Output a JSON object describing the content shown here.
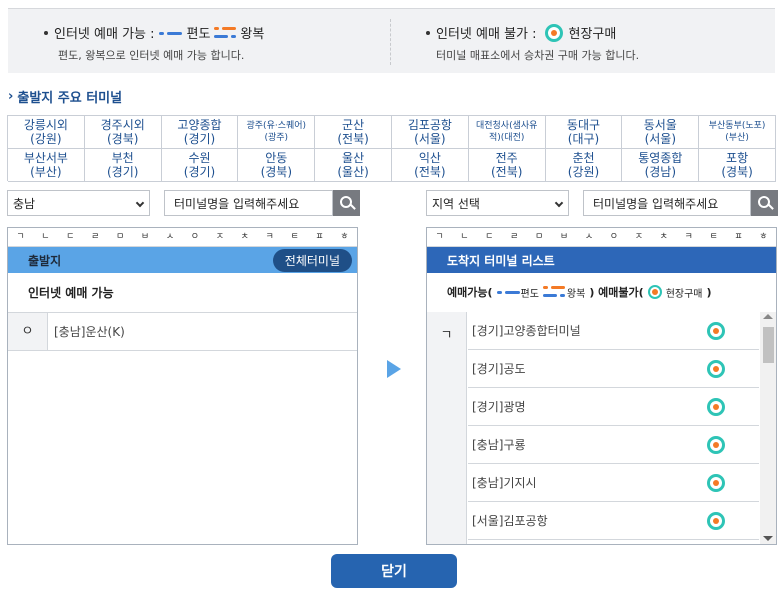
{
  "legend": {
    "online_label": "인터넷 예매 가능 :",
    "oneway_label": "편도",
    "roundtrip_label": "왕복",
    "online_desc": "편도, 왕복으로 인터넷 예매 가능 합니다.",
    "offline_label": "인터넷 예매 불가 :",
    "onsite_label": "현장구매",
    "offline_desc": "터미널 매표소에서 승차권 구매 가능 합니다."
  },
  "major": {
    "title": "출발지 주요 터미널",
    "terminals": [
      {
        "name": "강릉시외",
        "region": "(강원)",
        "small": false
      },
      {
        "name": "경주시외",
        "region": "(경북)",
        "small": false
      },
      {
        "name": "고양종합",
        "region": "(경기)",
        "small": false
      },
      {
        "name": "광주(유·스퀘어)",
        "region": "(광주)",
        "small": true
      },
      {
        "name": "군산",
        "region": "(전북)",
        "small": false
      },
      {
        "name": "김포공항",
        "region": "(서울)",
        "small": false
      },
      {
        "name": "대전청사(샘사유",
        "region": "적)(대전)",
        "small": true
      },
      {
        "name": "동대구",
        "region": "(대구)",
        "small": false
      },
      {
        "name": "동서울",
        "region": "(서울)",
        "small": false
      },
      {
        "name": "부산동부(노포)",
        "region": "(부산)",
        "small": true
      },
      {
        "name": "부산서부",
        "region": "(부산)",
        "small": false
      },
      {
        "name": "부천",
        "region": "(경기)",
        "small": false
      },
      {
        "name": "수원",
        "region": "(경기)",
        "small": false
      },
      {
        "name": "안동",
        "region": "(경북)",
        "small": false
      },
      {
        "name": "울산",
        "region": "(울산)",
        "small": false
      },
      {
        "name": "익산",
        "region": "(전북)",
        "small": false
      },
      {
        "name": "전주",
        "region": "(전북)",
        "small": false
      },
      {
        "name": "춘천",
        "region": "(강원)",
        "small": false
      },
      {
        "name": "통영종합",
        "region": "(경남)",
        "small": false
      },
      {
        "name": "포항",
        "region": "(경북)",
        "small": false
      }
    ]
  },
  "left": {
    "region_select": "충남",
    "search_placeholder": "터미널명을 입력해주세요",
    "consonants": [
      "ㄱ",
      "ㄴ",
      "ㄷ",
      "ㄹ",
      "ㅁ",
      "ㅂ",
      "ㅅ",
      "ㅇ",
      "ㅈ",
      "ㅊ",
      "ㅋ",
      "ㅌ",
      "ㅍ",
      "ㅎ"
    ],
    "header_title": "출발지",
    "all_button": "전체터미널",
    "sub_title": "인터넷 예매 가능",
    "rows": [
      {
        "letter": "ㅇ",
        "name": "[충남]운산(K)"
      }
    ]
  },
  "right": {
    "region_select": "지역 선택",
    "search_placeholder": "터미널명을 입력해주세요",
    "consonants": [
      "ㄱ",
      "ㄴ",
      "ㄷ",
      "ㄹ",
      "ㅁ",
      "ㅂ",
      "ㅅ",
      "ㅇ",
      "ㅈ",
      "ㅊ",
      "ㅋ",
      "ㅌ",
      "ㅍ",
      "ㅎ"
    ],
    "header_title": "도착지 터미널 리스트",
    "legend_prefix": "예매가능(",
    "legend_oneway": "편도",
    "legend_round": "왕복",
    "legend_mid": ") 예매불가(",
    "legend_onsite": "현장구매",
    "legend_suffix": ")",
    "group_letter": "ㄱ",
    "rows": [
      {
        "name": "[경기]고양종합터미널"
      },
      {
        "name": "[경기]공도"
      },
      {
        "name": "[경기]광명"
      },
      {
        "name": "[충남]구룡"
      },
      {
        "name": "[충남]기지시"
      },
      {
        "name": "[서울]김포공항"
      }
    ]
  },
  "close_button": "닫기",
  "colors": {
    "accent": "#2664b0",
    "left_header": "#5aa4e6",
    "right_header": "#2d67b8",
    "link": "#1d4f8f",
    "oneway": "#3b7ad6",
    "roundtrip": "#f47a26",
    "onsite_ring": "#2ec4b6"
  }
}
